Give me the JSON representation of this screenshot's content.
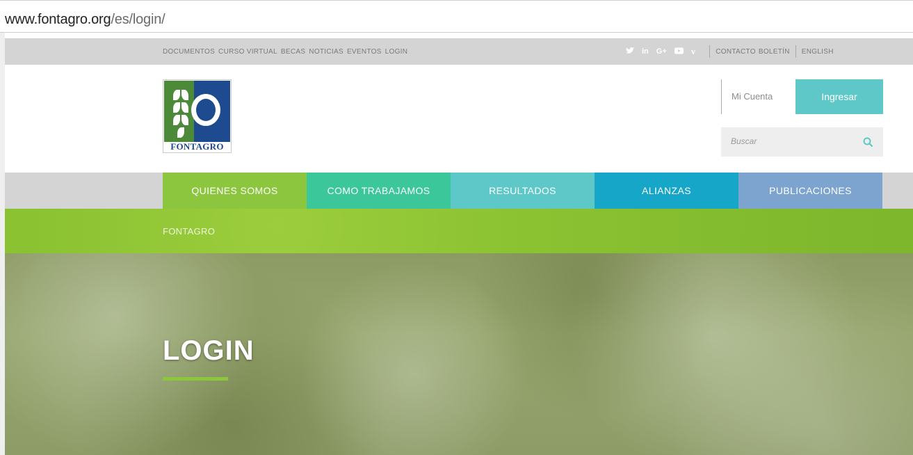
{
  "browser": {
    "url_host": "www.fontagro.org",
    "url_path": "/es/login/"
  },
  "topbar": {
    "links": [
      "DOCUMENTOS",
      "CURSO VIRTUAL",
      "BECAS",
      "NOTICIAS",
      "EVENTOS",
      "LOGIN"
    ],
    "social_icons": [
      {
        "name": "twitter-icon",
        "glyph": "🐦"
      },
      {
        "name": "linkedin-icon",
        "glyph": "in"
      },
      {
        "name": "google-plus-icon",
        "glyph": "G+"
      },
      {
        "name": "youtube-icon",
        "glyph": "▶"
      },
      {
        "name": "vimeo-icon",
        "glyph": "V"
      }
    ],
    "contacto": "CONTACTO",
    "boletin": "BOLETÍN",
    "english": "ENGLISH"
  },
  "header": {
    "logo_text": "FONTAGRO",
    "account_label": "Mi Cuenta",
    "login_button": "Ingresar",
    "search_placeholder": "Buscar"
  },
  "nav": {
    "items": [
      {
        "label": "QUIENES SOMOS",
        "color": "#8cc63e"
      },
      {
        "label": "COMO TRABAJAMOS",
        "color": "#3cc79a"
      },
      {
        "label": "RESULTADOS",
        "color": "#5ec8c8"
      },
      {
        "label": "ALIANZAS",
        "color": "#16a6c8"
      },
      {
        "label": "PUBLICACIONES",
        "color": "#7da3cf"
      }
    ]
  },
  "breadcrumb": {
    "item": "FONTAGRO"
  },
  "hero": {
    "title": "LOGIN"
  },
  "colors": {
    "accent_green": "#8cc63e",
    "accent_teal": "#5ec8c8"
  }
}
